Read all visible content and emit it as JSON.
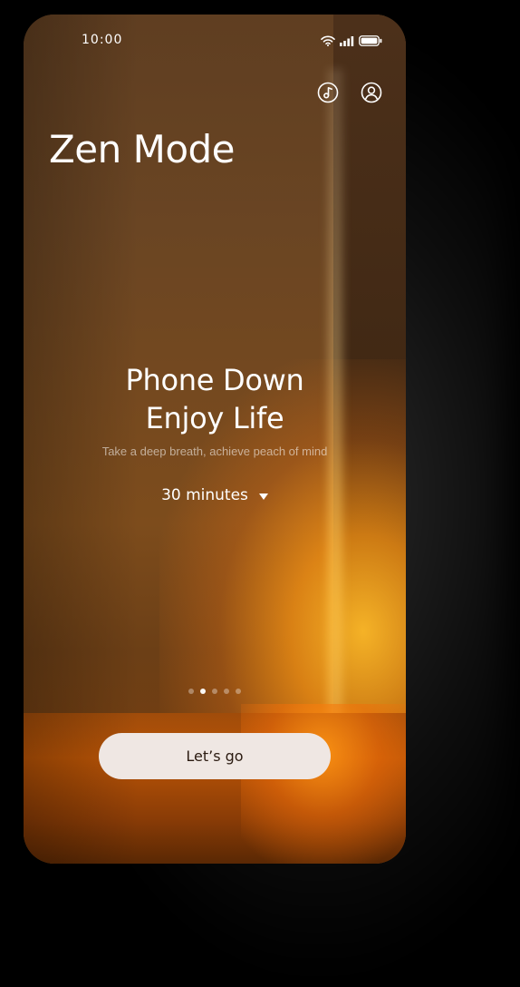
{
  "status_bar": {
    "time": "10:00",
    "icons": [
      "wifi-icon",
      "signal-icon",
      "battery-icon"
    ]
  },
  "header": {
    "title": "Zen Mode",
    "actions": [
      {
        "icon": "music-note-icon"
      },
      {
        "icon": "user-profile-icon"
      }
    ]
  },
  "main": {
    "headline_line1": "Phone Down",
    "headline_line2": "Enjoy Life",
    "subtitle": "Take a deep breath, achieve peach of mind",
    "duration": {
      "value": "30 minutes",
      "icon": "caret-down-icon"
    }
  },
  "pager": {
    "count": 5,
    "active_index": 1
  },
  "cta": {
    "label": "Let’s go"
  },
  "colors": {
    "cta_background": "#efe7e3",
    "cta_text": "#2a1a10",
    "accent_glow": "#ffb82a"
  }
}
